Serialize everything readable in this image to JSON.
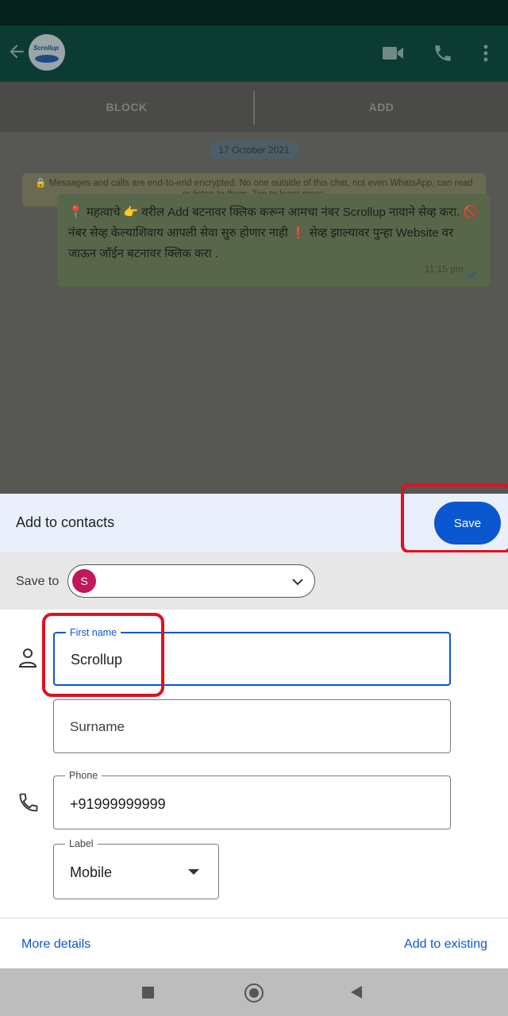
{
  "whatsapp": {
    "avatar_text": "Scrollup",
    "actions": {
      "block": "BLOCK",
      "add": "ADD"
    },
    "date_chip": "17 October 2021",
    "encryption_notice": "🔒 Messages and calls are end-to-end encrypted. No one outside of this chat, not even WhatsApp, can read or listen to them. Tap to learn more.",
    "message": {
      "text": "📍 महत्वाचे 👉 वरील Add बटनावर क्लिक करून आमचा नंबर Scrollup नावाने सेव्ह करा. 🚫 नंबर सेव्ह केल्याशिवाय आपली सेवा सुरु होणार नाही ❗ सेव्ह झाल्यावर पुन्हा Website वर जाऊन जॉईन बटनावर क्लिक करा .",
      "time": "11:15 pm"
    }
  },
  "sheet": {
    "title": "Add to contacts",
    "save_label": "Save",
    "save_to_label": "Save to",
    "account_initial": "S"
  },
  "form": {
    "first_name": {
      "label": "First name",
      "value": "Scrollup"
    },
    "surname": {
      "placeholder": "Surname"
    },
    "phone": {
      "label": "Phone",
      "value": "+91999999999"
    },
    "phone_label": {
      "label": "Label",
      "value": "Mobile"
    }
  },
  "footer": {
    "more_details": "More details",
    "add_to_existing": "Add to existing"
  },
  "colors": {
    "accent": "#0b57d0",
    "highlight": "#e01020",
    "account_avatar": "#c2185b"
  },
  "icons": [
    "back-arrow-icon",
    "video-call-icon",
    "voice-call-icon",
    "more-vert-icon",
    "chevron-down-icon",
    "person-icon",
    "phone-icon",
    "nav-recents-icon",
    "nav-home-icon",
    "nav-back-icon"
  ]
}
